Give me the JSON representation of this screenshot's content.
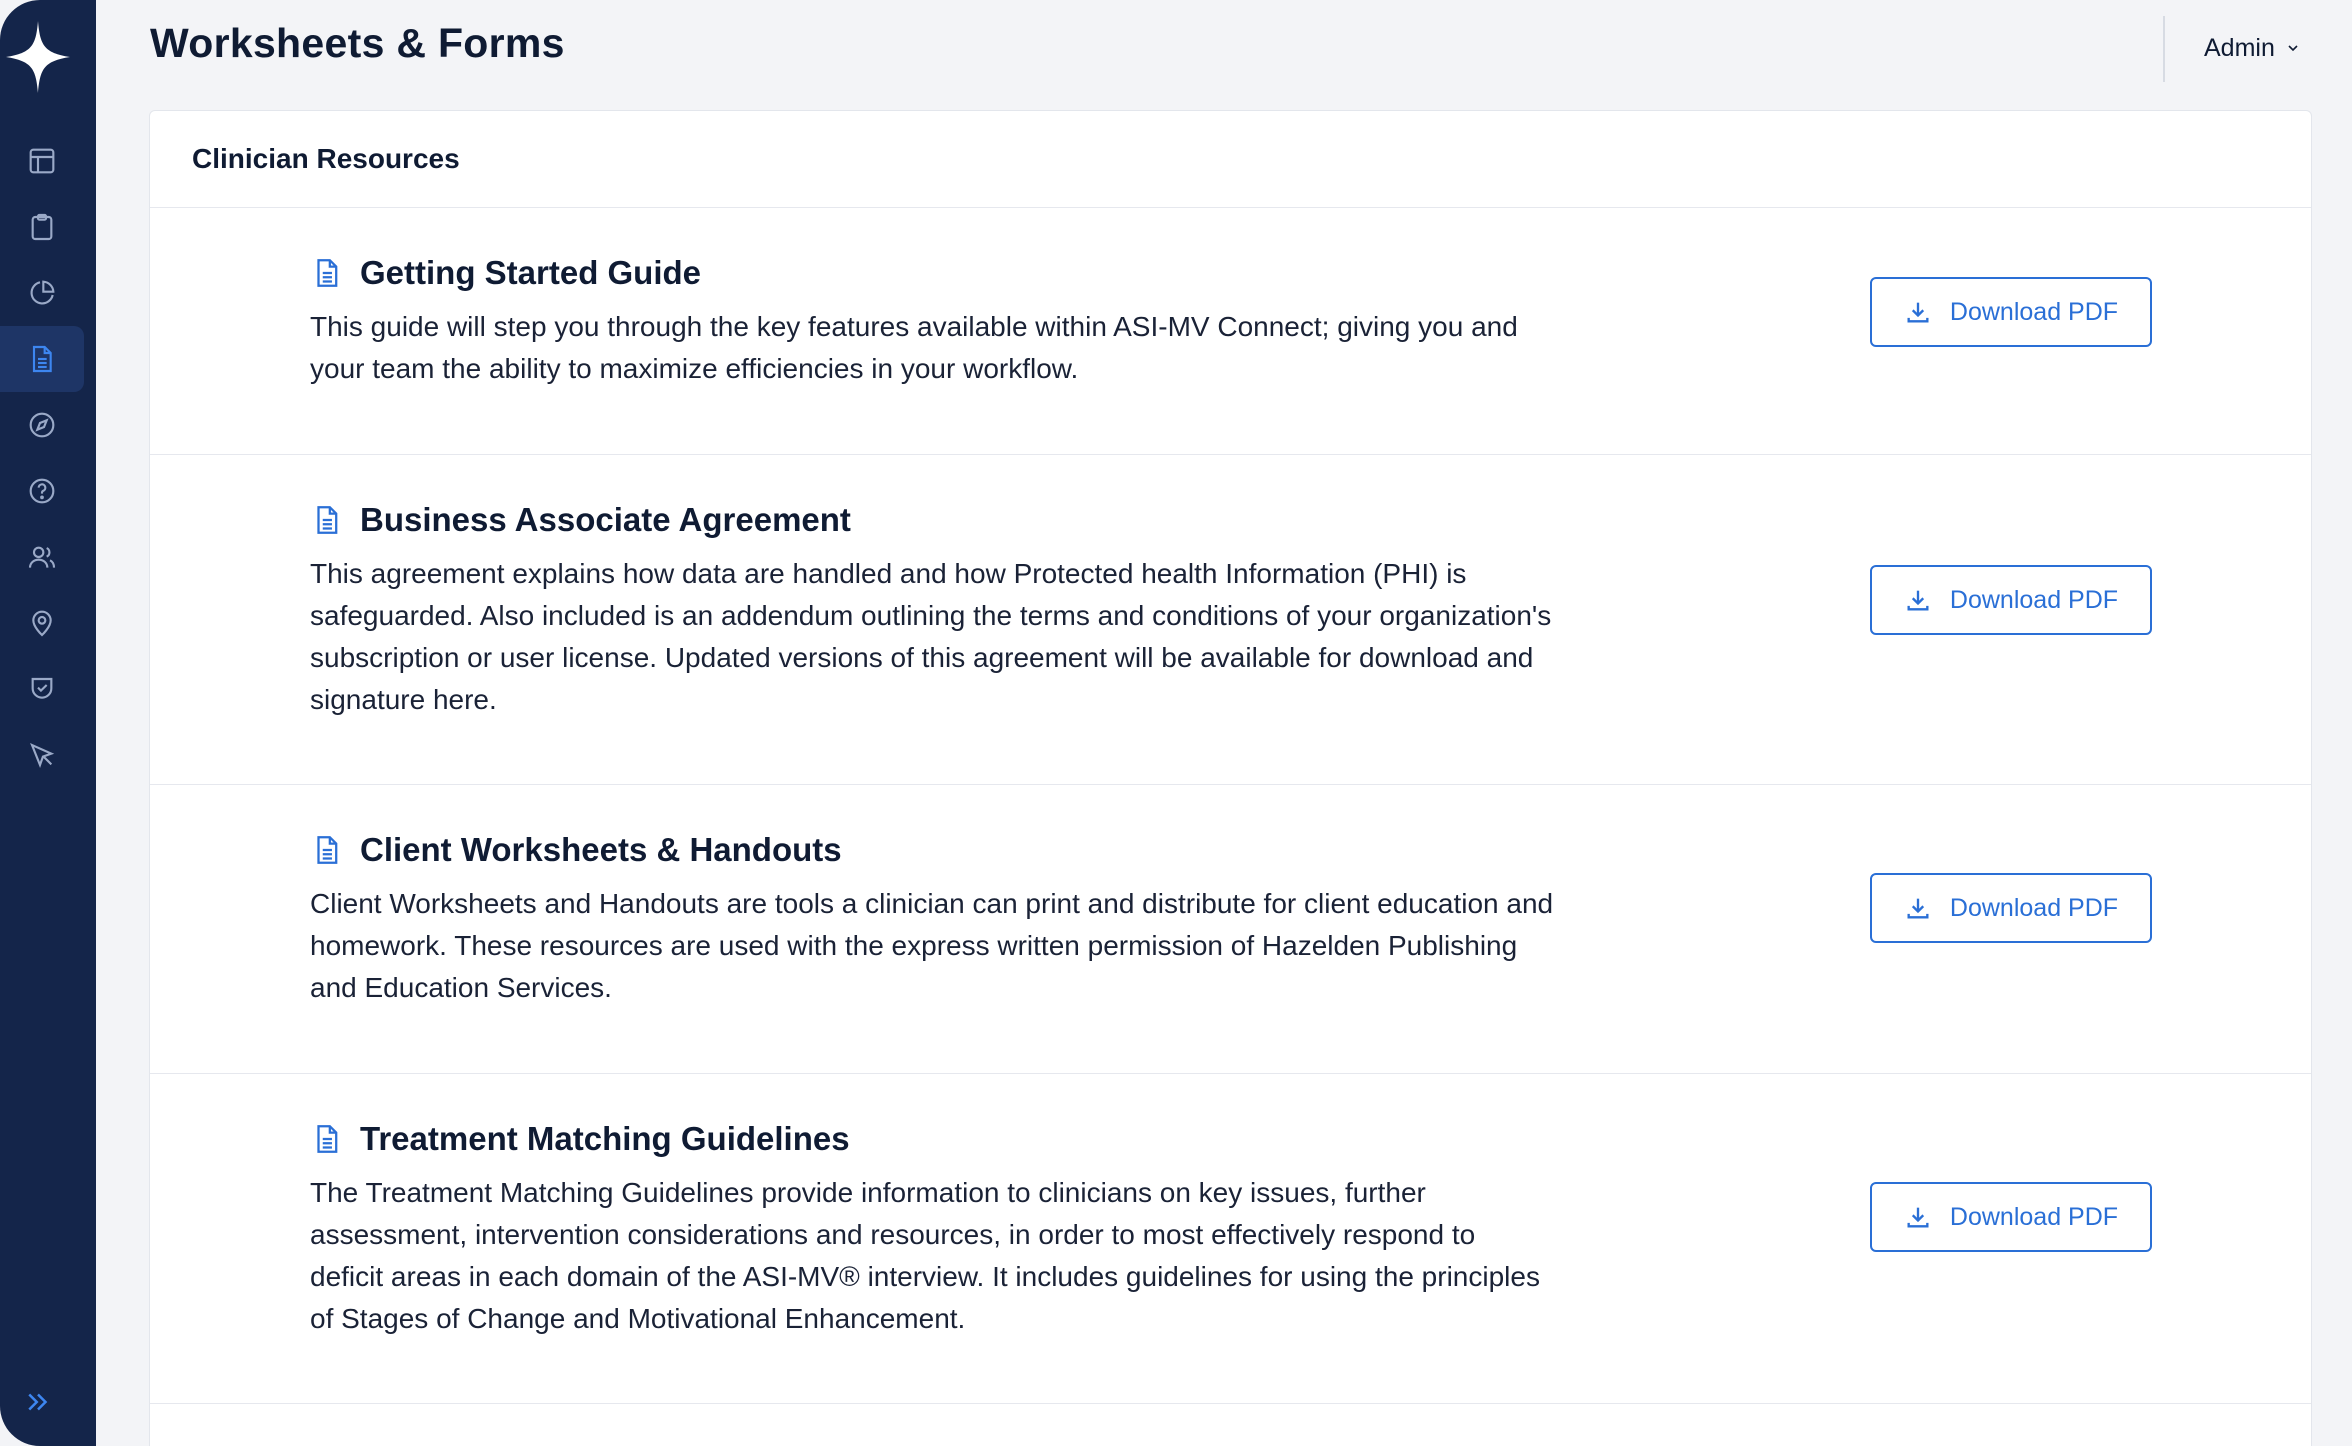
{
  "header": {
    "title": "Worksheets & Forms",
    "user_menu_label": "Admin"
  },
  "sidebar": {
    "items": [
      {
        "icon": "layout-icon"
      },
      {
        "icon": "clipboard-icon"
      },
      {
        "icon": "pie-chart-icon"
      },
      {
        "icon": "document-icon",
        "active": true
      },
      {
        "icon": "compass-icon"
      },
      {
        "icon": "help-circle-icon"
      },
      {
        "icon": "users-icon"
      },
      {
        "icon": "map-pin-icon"
      },
      {
        "icon": "shield-check-icon"
      },
      {
        "icon": "cursor-icon"
      }
    ],
    "expand_icon": "double-chevron-right-icon"
  },
  "panel": {
    "title": "Clinician Resources",
    "resources": [
      {
        "title": "Getting Started Guide",
        "description": "This guide will step you through the key features available within ASI-MV Connect; giving you and your team the ability to maximize efficiencies in your workflow.",
        "button_label": "Download PDF"
      },
      {
        "title": "Business Associate Agreement",
        "description": "This agreement explains how data are handled and how Protected health Information (PHI) is safeguarded. Also included is an addendum outlining the terms and conditions of your organization's subscription or user license. Updated versions of this agreement will be available for download and signature here.",
        "button_label": "Download PDF"
      },
      {
        "title": "Client Worksheets & Handouts",
        "description": "Client Worksheets and Handouts are tools a clinician can print and distribute for client education and homework. These resources are used with the express written permission of Hazelden Publishing and Education Services.",
        "button_label": "Download PDF"
      },
      {
        "title": "Treatment Matching Guidelines",
        "description": "The Treatment Matching Guidelines provide information to clinicians on key issues, further assessment, intervention considerations and resources, in order to most effectively respond to deficit areas in each domain of the ASI-MV® interview. It includes guidelines for using the principles of Stages of Change and Motivational Enhancement.",
        "button_label": "Download PDF"
      }
    ]
  },
  "colors": {
    "sidebar_bg": "#14254a",
    "accent": "#2a6fd6",
    "icon_muted": "#9aa9c7"
  }
}
